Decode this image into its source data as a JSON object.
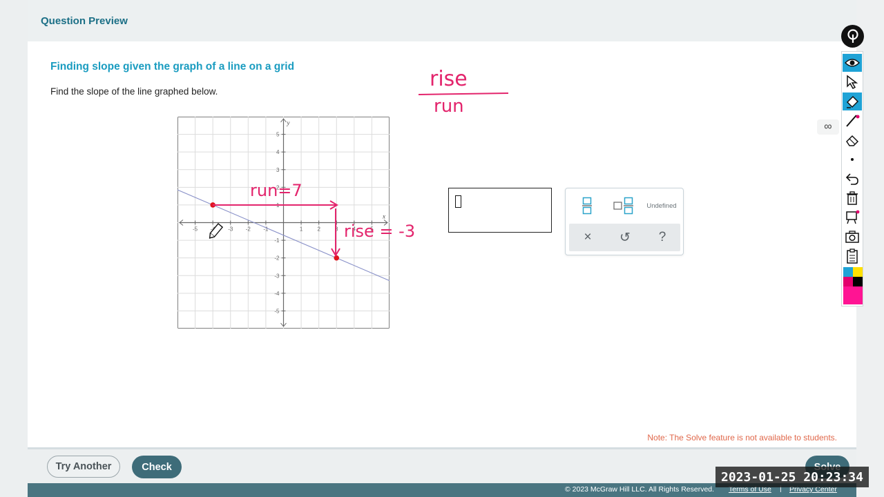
{
  "header": {
    "title": "Question Preview"
  },
  "question": {
    "title": "Finding slope given the graph of a line on a grid",
    "prompt": "Find the slope of the line graphed below."
  },
  "graph": {
    "x_axis_label": "x",
    "y_axis_label": "y",
    "x_ticks": [
      "-5",
      "-4",
      "-3",
      "-2",
      "-1",
      "1",
      "2",
      "3",
      "4",
      "5"
    ],
    "y_ticks": [
      "5",
      "4",
      "3",
      "2",
      "1",
      "-1",
      "-2",
      "-3",
      "-4",
      "-5"
    ],
    "line_points": [
      [
        -4,
        1
      ],
      [
        3,
        -2
      ]
    ],
    "point_color": "#e0141e",
    "line_color": "#8890c8"
  },
  "annotations": {
    "fraction_top": "rise",
    "fraction_bottom": "run",
    "run_label": "run=7",
    "rise_label": "rise = -3",
    "ink_color": "#e3246c"
  },
  "answer": {
    "value": ""
  },
  "palette": {
    "fraction_icon": "fraction-icon",
    "mixed_number_icon": "mixed-number-icon",
    "undefined_label": "Undefined",
    "clear_symbol": "×",
    "undo_symbol": "↺",
    "help_symbol": "?"
  },
  "note": "Note: The Solve feature is not available to students.",
  "footer": {
    "try_another": "Try Another",
    "check": "Check",
    "solve": "Solve",
    "copyright": "© 2023 McGraw Hill LLC. All Rights Reserved.",
    "terms": "Terms of Use",
    "separator": "|",
    "privacy": "Privacy Center"
  },
  "timestamp": "2023-01-25  20:23:34",
  "toolbar": {
    "tools": [
      "eye-icon",
      "pointer-icon",
      "highlighter-icon",
      "pen-icon",
      "eraser-icon",
      "dot-icon",
      "undo-icon",
      "trash-icon",
      "whiteboard-icon",
      "camera-icon",
      "clipboard-icon"
    ],
    "colors": [
      "#1fa3d6",
      "#ffe000",
      "#e3006d",
      "#000000",
      "#ff1493"
    ],
    "accent": "#1fa3d6"
  },
  "glasses_icon": "glasses-icon"
}
